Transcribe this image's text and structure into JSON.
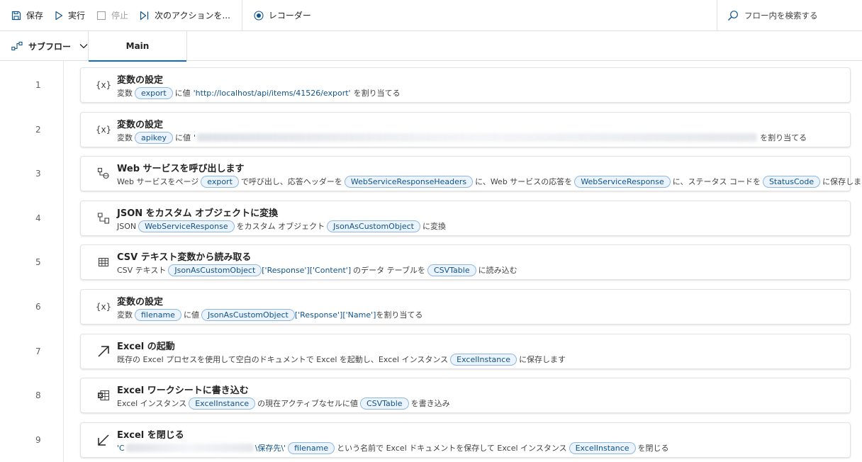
{
  "toolbar": {
    "save": "保存",
    "run": "実行",
    "stop": "停止",
    "next_action": "次のアクションを...",
    "recorder": "レコーダー",
    "search_placeholder": "フロー内を検索する"
  },
  "tabs": {
    "subflow": "サブフロー",
    "main": "Main"
  },
  "actions": [
    {
      "line": "1",
      "icon": "variable-icon",
      "icon_text": "{x}",
      "title": "変数の設定",
      "p1": "変数",
      "var1": "export",
      "p2": "に値",
      "lit1": "'http://localhost/api/items/41526/export'",
      "p3": "を割り当てる"
    },
    {
      "line": "2",
      "icon": "variable-icon",
      "icon_text": "{x}",
      "title": "変数の設定",
      "p1": "変数",
      "var1": "apikey",
      "p2": "に値",
      "lit1": "'",
      "p3": "を割り当てる"
    },
    {
      "line": "3",
      "icon": "web-service-icon",
      "title": "Web サービスを呼び出します",
      "p1": "Web サービスをページ",
      "var1": "export",
      "p2": "で呼び出し、応答ヘッダーを",
      "var2": "WebServiceResponseHeaders",
      "p3": "に、Web サービスの応答を",
      "var3": "WebServiceResponse",
      "p4": "に、ステータス コードを",
      "var4": "StatusCode",
      "p5": "に保存します"
    },
    {
      "line": "4",
      "icon": "json-convert-icon",
      "title": "JSON をカスタム オブジェクトに変換",
      "p1": "JSON",
      "var1": "WebServiceResponse",
      "p2": "をカスタム オブジェクト",
      "var2": "JsonAsCustomObject",
      "p3": "に変換"
    },
    {
      "line": "5",
      "icon": "table-icon",
      "title": "CSV テキスト変数から読み取る",
      "p1": "CSV テキスト",
      "var1": "JsonAsCustomObject",
      "lit1": "['Response']['Content']",
      "p2": "のデータ テーブルを",
      "var2": "CSVTable",
      "p3": "に読み込む"
    },
    {
      "line": "6",
      "icon": "variable-icon",
      "icon_text": "{x}",
      "title": "変数の設定",
      "p1": "変数",
      "var1": "filename",
      "p2": "に値",
      "var2": "JsonAsCustomObject",
      "lit1": "['Response']['Name']",
      "p3": "を割り当てる"
    },
    {
      "line": "7",
      "icon": "arrow-up-right-icon",
      "title": "Excel の起動",
      "p1": "既存の Excel プロセスを使用して空白のドキュメントで Excel を起動し、Excel インスタンス",
      "var1": "ExcelInstance",
      "p2": "に保存します"
    },
    {
      "line": "8",
      "icon": "excel-write-icon",
      "title": "Excel ワークシートに書き込む",
      "p1": "Excel インスタンス",
      "var1": "ExcelInstance",
      "p2": "の現在アクティブなセルに値",
      "var2": "CSVTable",
      "p3": "を書き込み"
    },
    {
      "line": "9",
      "icon": "arrow-down-left-icon",
      "title": "Excel を閉じる",
      "lit1": "'C",
      "lit2": "\\保存先\\'",
      "var1": "filename",
      "p1": "という名前で Excel ドキュメントを保存して Excel インスタンス",
      "var2": "ExcelInstance",
      "p2": "を閉じる"
    }
  ]
}
